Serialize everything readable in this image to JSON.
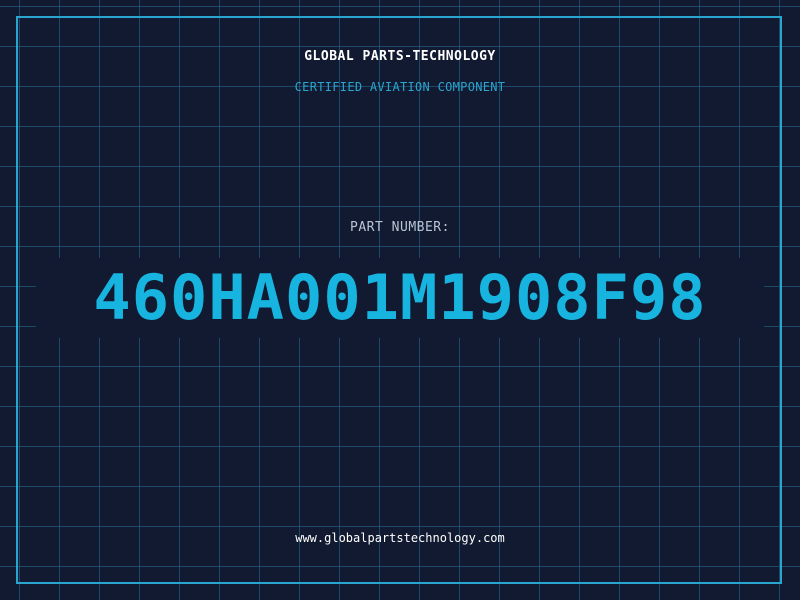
{
  "header": {
    "company": "GLOBAL PARTS-TECHNOLOGY",
    "subtitle": "CERTIFIED AVIATION COMPONENT"
  },
  "part": {
    "label": "PART NUMBER:",
    "number": "460HA001M1908F98"
  },
  "footer": {
    "website": "www.globalpartstechnology.com"
  },
  "colors": {
    "background": "#111a30",
    "grid": "#286e96",
    "accent": "#18b4e0",
    "border": "#2aa5cf"
  }
}
